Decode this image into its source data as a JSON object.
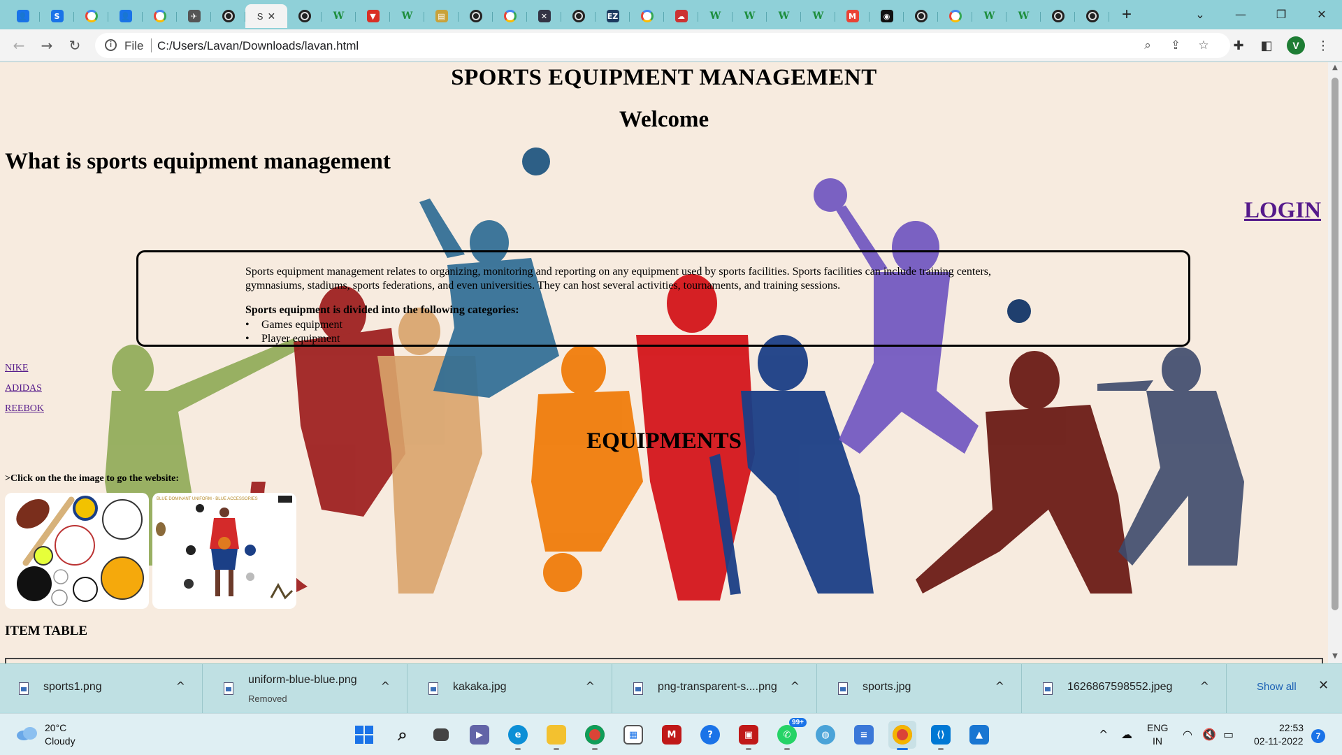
{
  "browser": {
    "active_tab_title": "S",
    "tabs": [
      {
        "icon": "contacts-icon",
        "color": "#1a73e8",
        "glyph": "👤"
      },
      {
        "icon": "s-app-icon",
        "color": "#1a73e8",
        "glyph": "S"
      },
      {
        "icon": "google-icon"
      },
      {
        "icon": "contacts-icon",
        "color": "#1a73e8",
        "glyph": "👤"
      },
      {
        "icon": "google-icon"
      },
      {
        "icon": "bird-icon",
        "color": "#555",
        "glyph": "✈"
      },
      {
        "icon": "globe-icon"
      },
      {
        "icon": "page-icon",
        "active": true
      },
      {
        "icon": "globe-icon"
      },
      {
        "icon": "wiki-icon"
      },
      {
        "icon": "v-icon",
        "color": "#d93025",
        "glyph": "▼"
      },
      {
        "icon": "wiki-icon"
      },
      {
        "icon": "image-icon",
        "color": "#c8a23a",
        "glyph": "▤"
      },
      {
        "icon": "globe-icon"
      },
      {
        "icon": "google-icon"
      },
      {
        "icon": "x-tool-icon",
        "color": "#334",
        "glyph": "✕"
      },
      {
        "icon": "globe-icon"
      },
      {
        "icon": "ez-icon",
        "color": "#1d3a5f",
        "glyph": "EZ"
      },
      {
        "icon": "google-icon"
      },
      {
        "icon": "cloud-icon",
        "color": "#c33",
        "glyph": "☁"
      },
      {
        "icon": "wiki-icon"
      },
      {
        "icon": "wiki-icon"
      },
      {
        "icon": "wiki-icon"
      },
      {
        "icon": "wiki-icon"
      },
      {
        "icon": "gmail-icon",
        "color": "#ea4335",
        "glyph": "M"
      },
      {
        "icon": "github-icon",
        "color": "#111",
        "glyph": "◉"
      },
      {
        "icon": "globe-icon"
      },
      {
        "icon": "google-icon"
      },
      {
        "icon": "wiki-icon"
      },
      {
        "icon": "wiki-icon"
      },
      {
        "icon": "globe-icon"
      },
      {
        "icon": "globe-icon"
      }
    ],
    "address": {
      "scheme_label": "File",
      "url": "C:/Users/Lavan/Downloads/lavan.html"
    },
    "profile_initial": "V"
  },
  "page": {
    "title": "SPORTS EQUIPMENT MANAGEMENT",
    "welcome": "Welcome",
    "what_heading": "What is sports equipment management",
    "login": "LOGIN",
    "description": "Sports equipment management relates to organizing, monitoring and reporting on any equipment used by sports facilities. Sports facilities can include training centers, gymnasiums, stadiums, sports federations, and even universities. They can host several activities, tournaments, and training sessions.",
    "categories_title": "Sports equipment is divided into the following categories:",
    "categories": [
      "Games equipment",
      "Player equipment"
    ],
    "brands": [
      "NIKE",
      "ADIDAS",
      "REEBOK"
    ],
    "equipments_heading": "EQUIPMENTS",
    "click_note": ">Click on the the image to go the website:",
    "uniform_caption": "BLUE DOMINANT UNIFORM - BLUE ACCESSORIES",
    "item_table_label": "ITEM TABLE"
  },
  "downloads": {
    "items": [
      {
        "name": "sports1.png",
        "status": ""
      },
      {
        "name": "uniform-blue-blue.png",
        "status": "Removed"
      },
      {
        "name": "kakaka.jpg",
        "status": ""
      },
      {
        "name": "png-transparent-s....png",
        "status": ""
      },
      {
        "name": "sports.jpg",
        "status": ""
      },
      {
        "name": "1626867598552.jpeg",
        "status": ""
      }
    ],
    "show_all": "Show all"
  },
  "taskbar": {
    "temperature": "20°C",
    "condition": "Cloudy",
    "lang_line1": "ENG",
    "lang_line2": "IN",
    "time": "22:53",
    "date": "02-11-2022",
    "notification_count": "7",
    "whatsapp_badge": "99+"
  },
  "colors": {
    "page_bg": "#f7ebdf",
    "link_visited": "#551a8b",
    "tab_strip": "#8fd0d8",
    "download_shelf": "#bfe0e3",
    "taskbar": "#dfeff3"
  }
}
